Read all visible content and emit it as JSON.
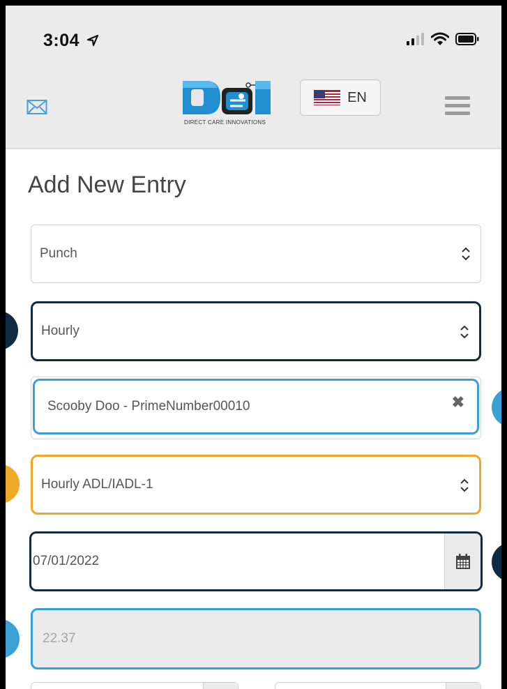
{
  "status_bar": {
    "time": "3:04"
  },
  "header": {
    "language_label": "EN",
    "logo_text": "DCI DIRECT CARE INNOVATIONS"
  },
  "page": {
    "title": "Add New Entry"
  },
  "form": {
    "entry_type": "Punch",
    "billing_type": "Hourly",
    "client": "Scooby Doo - PrimeNumber00010",
    "service": "Hourly ADL/IADL-1",
    "date": "07/01/2022",
    "units": "22.37"
  },
  "colors": {
    "navy": "#0f2b44",
    "blue": "#3aa0d8",
    "orange": "#f1a826",
    "header_gray": "#ebebeb"
  }
}
